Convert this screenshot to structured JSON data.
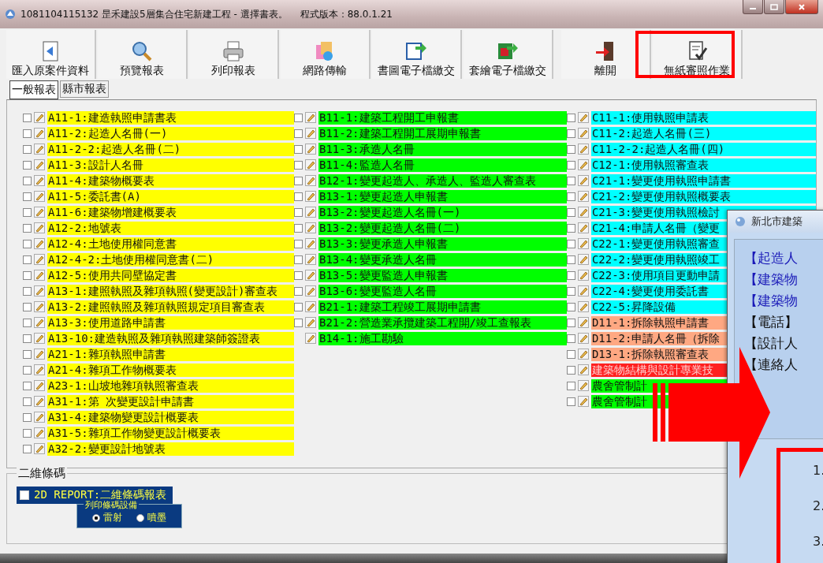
{
  "window": {
    "title": "1081104115132 昰禾建設5層集合住宅新建工程 - 選擇書表。",
    "version": "程式版本：88.0.1.21"
  },
  "toolbar": [
    {
      "label": "匯入原案件資料",
      "kind": "import"
    },
    {
      "label": "預覽報表",
      "kind": "preview"
    },
    {
      "label": "列印報表",
      "kind": "print"
    },
    {
      "label": "網路傳輸",
      "kind": "network"
    },
    {
      "label": "書圖電子檔繳交",
      "kind": "export"
    },
    {
      "label": "套繪電子檔繳交",
      "kind": "export2"
    },
    {
      "label": "離開",
      "kind": "exit"
    },
    {
      "label": "無紙審照作業",
      "kind": "paper"
    }
  ],
  "tabs": [
    {
      "label": "一般報表",
      "selected": true
    },
    {
      "label": "縣市報表",
      "selected": false
    }
  ],
  "columns": [
    {
      "items": [
        {
          "label": "A11-1:建造執照申請書表",
          "color": "#ffff00",
          "kind": "checkbox",
          "checked": false
        },
        {
          "label": "A11-2:起造人名冊(一)",
          "color": "#ffff00",
          "kind": "checkbox",
          "checked": false
        },
        {
          "label": "A11-2-2:起造人名冊(二)",
          "color": "#ffff00",
          "kind": "checkbox",
          "checked": false
        },
        {
          "label": "A11-3:設計人名冊",
          "color": "#ffff00",
          "kind": "checkbox",
          "checked": false
        },
        {
          "label": "A11-4:建築物概要表",
          "color": "#ffff00",
          "kind": "checkbox",
          "checked": false
        },
        {
          "label": "A11-5:委託書(A)",
          "color": "#ffff00",
          "kind": "checkbox",
          "checked": false
        },
        {
          "label": "A11-6:建築物增建概要表",
          "color": "#ffff00",
          "kind": "checkbox",
          "checked": false
        },
        {
          "label": "A12-2:地號表",
          "color": "#ffff00",
          "kind": "checkbox",
          "checked": false
        },
        {
          "label": "A12-4:土地使用權同意書",
          "color": "#ffff00",
          "kind": "checkbox",
          "checked": false
        },
        {
          "label": "A12-4-2:土地使用權同意書(二)",
          "color": "#ffff00",
          "kind": "checkbox",
          "checked": false
        },
        {
          "label": "A12-5:使用共同壁協定書",
          "color": "#ffff00",
          "kind": "checkbox",
          "checked": false
        },
        {
          "label": "A13-1:建照執照及雜項執照(變更設計)審查表",
          "color": "#ffff00",
          "kind": "checkbox",
          "checked": false
        },
        {
          "label": "A13-2:建照執照及雜項執照規定項目審查表",
          "color": "#ffff00",
          "kind": "checkbox",
          "checked": false
        },
        {
          "label": "A13-3:使用道路申請書",
          "color": "#ffff00",
          "kind": "checkbox",
          "checked": false
        },
        {
          "label": "A13-10:建造執照及雜項執照建築師簽證表",
          "color": "#ffff00",
          "kind": "checkbox",
          "checked": false
        },
        {
          "label": "A21-1:雜項執照申請書",
          "color": "#ffff00",
          "kind": "checkbox",
          "checked": false
        },
        {
          "label": "A21-4:雜項工作物概要表",
          "color": "#ffff00",
          "kind": "checkbox",
          "checked": false
        },
        {
          "label": "A23-1:山坡地雜項執照審查表",
          "color": "#ffff00",
          "kind": "checkbox",
          "checked": false
        },
        {
          "label": "A31-1:第 次變更設計申請書",
          "color": "#ffff00",
          "kind": "checkbox",
          "checked": false
        },
        {
          "label": "A31-4:建築物變更設計概要表",
          "color": "#ffff00",
          "kind": "checkbox",
          "checked": false
        },
        {
          "label": "A31-5:雜項工作物變更設計概要表",
          "color": "#ffff00",
          "kind": "checkbox",
          "checked": false
        },
        {
          "label": "A32-2:變更設計地號表",
          "color": "#ffff00",
          "kind": "checkbox",
          "checked": false
        }
      ]
    },
    {
      "items": [
        {
          "label": "B11-1:建築工程開工申報書",
          "color": "#00ff00",
          "kind": "checkbox",
          "checked": false
        },
        {
          "label": "B11-2:建築工程開工展期申報書",
          "color": "#00ff00",
          "kind": "checkbox",
          "checked": false
        },
        {
          "label": "B11-3:承造人名冊",
          "color": "#00ff00",
          "kind": "checkbox",
          "checked": false
        },
        {
          "label": "B11-4:監造人名冊",
          "color": "#00ff00",
          "kind": "checkbox",
          "checked": false
        },
        {
          "label": "B12-1:變更起造人、承造人、監造人審查表",
          "color": "#00ff00",
          "kind": "checkbox",
          "checked": false
        },
        {
          "label": "B13-1:變更起造人申報書",
          "color": "#00ff00",
          "kind": "checkbox",
          "checked": false
        },
        {
          "label": "B13-2:變更起造人名冊(一)",
          "color": "#00ff00",
          "kind": "checkbox",
          "checked": false
        },
        {
          "label": "B13-2:變更起造人名冊(二)",
          "color": "#00ff00",
          "kind": "checkbox",
          "checked": false
        },
        {
          "label": "B13-3:變更承造人申報書",
          "color": "#00ff00",
          "kind": "checkbox",
          "checked": false
        },
        {
          "label": "B13-4:變更承造人名冊",
          "color": "#00ff00",
          "kind": "checkbox",
          "checked": false
        },
        {
          "label": "B13-5:變更監造人申報書",
          "color": "#00ff00",
          "kind": "checkbox",
          "checked": false
        },
        {
          "label": "B13-6:變更監造人名冊",
          "color": "#00ff00",
          "kind": "checkbox",
          "checked": false
        },
        {
          "label": "B21-1:建築工程竣工展期申請書",
          "color": "#00ff00",
          "kind": "checkbox",
          "checked": false
        },
        {
          "label": "B21-2:營造業承攬建築工程開/竣工查報表",
          "color": "#00ff00",
          "kind": "checkbox",
          "checked": false
        },
        {
          "label": "B14-1:施工勘驗",
          "color": "#00ff00",
          "kind": "plain"
        }
      ]
    },
    {
      "items": [
        {
          "label": "C11-1:使用執照申請表",
          "color": "#00ffff",
          "kind": "checkbox",
          "checked": false
        },
        {
          "label": "C11-2:起造人名冊(三)",
          "color": "#00ffff",
          "kind": "checkbox",
          "checked": false
        },
        {
          "label": "C11-2-2:起造人名冊(四)",
          "color": "#00ffff",
          "kind": "checkbox",
          "checked": false
        },
        {
          "label": "C12-1:使用執照審查表",
          "color": "#00ffff",
          "kind": "checkbox",
          "checked": false
        },
        {
          "label": "C21-1:變更使用執照申請書",
          "color": "#00ffff",
          "kind": "checkbox",
          "checked": false
        },
        {
          "label": "C21-2:變更使用執照概要表",
          "color": "#00ffff",
          "kind": "checkbox",
          "checked": false
        },
        {
          "label": "C21-3:變更使用執照檢討",
          "color": "#00ffff",
          "kind": "checkbox",
          "checked": false
        },
        {
          "label": "C21-4:申請人名冊（變更",
          "color": "#00ffff",
          "kind": "checkbox",
          "checked": false
        },
        {
          "label": "C22-1:變更使用執照審查",
          "color": "#00ffff",
          "kind": "checkbox",
          "checked": false
        },
        {
          "label": "C22-2:變更使用執照竣工",
          "color": "#00ffff",
          "kind": "checkbox",
          "checked": false
        },
        {
          "label": "C22-3:使用項目更動申請",
          "color": "#00ffff",
          "kind": "checkbox",
          "checked": false
        },
        {
          "label": "C22-4:變更使用委託書",
          "color": "#00ffff",
          "kind": "checkbox",
          "checked": false
        },
        {
          "label": "C22-5:昇降設備",
          "color": "#00ffff",
          "kind": "checkbox",
          "checked": false
        },
        {
          "label": "D11-1:拆除執照申請書",
          "color": "#ffa882",
          "kind": "checkbox",
          "checked": false
        },
        {
          "label": "D11-2:申請人名冊（拆除",
          "color": "#ffa882",
          "kind": "checkbox",
          "checked": false
        },
        {
          "label": "D13-1:拆除執照審查表",
          "color": "#ffa882",
          "kind": "checkbox",
          "checked": false
        },
        {
          "label": "建築物結構與設計專業技",
          "color": "#ff2020",
          "kind": "checkbox",
          "checked": false
        },
        {
          "label": "農舍管制計",
          "color": "#00ff00",
          "kind": "checkbox",
          "checked": false
        },
        {
          "label": "農舍管制計",
          "color": "#00ff00",
          "kind": "checkbox",
          "checked": false
        }
      ]
    }
  ],
  "barcode_group": {
    "title": "二維條碼",
    "item": {
      "label": "2D REPORT:二維條碼報表",
      "checked": false
    },
    "device_group": {
      "title": "列印條碼設備",
      "options": [
        {
          "label": "雷射",
          "selected": true
        },
        {
          "label": "噴墨",
          "selected": false
        }
      ]
    }
  },
  "dialog": {
    "title": "新北市建築",
    "lines": [
      {
        "text": "【起造人",
        "color": "#1a1ab8"
      },
      {
        "text": "【建築物",
        "color": "#1a1ab8"
      },
      {
        "text": "【建築物",
        "color": "#1a1ab8"
      },
      {
        "text": "【電話】",
        "color": "#111111"
      },
      {
        "text": "【設計人",
        "color": "#111111"
      },
      {
        "text": "【連絡人",
        "color": "#111111"
      }
    ],
    "numbers": [
      "1.",
      "2.",
      "3."
    ]
  }
}
